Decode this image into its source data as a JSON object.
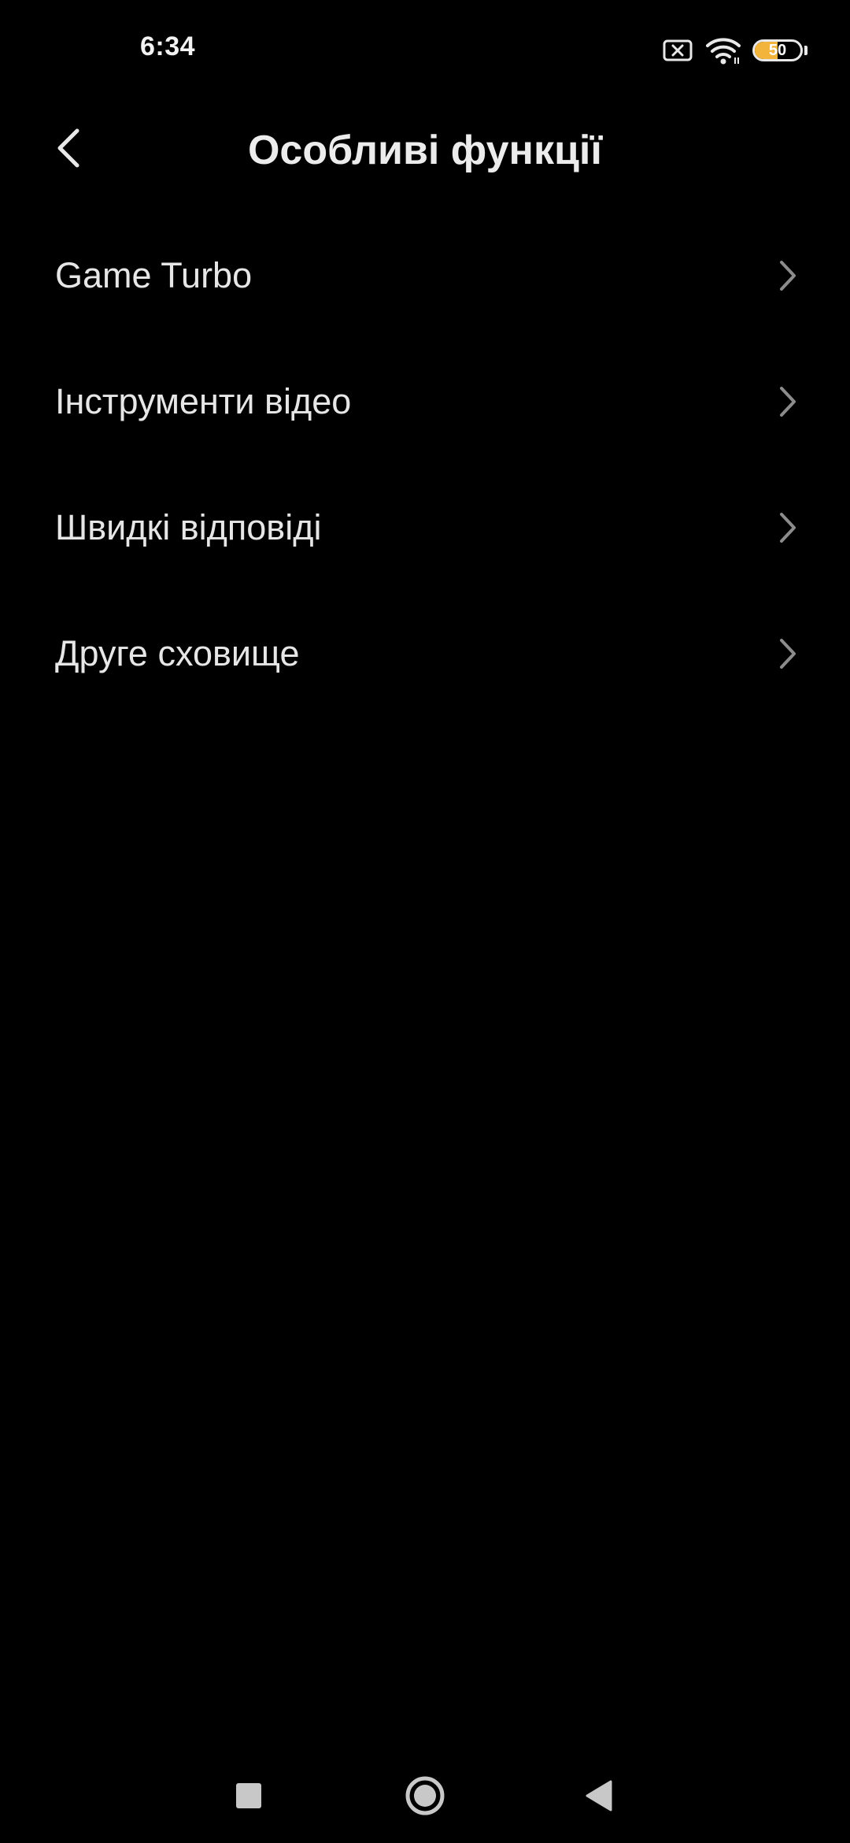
{
  "status_bar": {
    "time": "6:34",
    "battery_level": "50",
    "battery_fraction": 0.5,
    "icons": [
      "sim-missing-icon",
      "wifi-icon",
      "battery-icon"
    ]
  },
  "header": {
    "title": "Особливі функції",
    "back_icon": "chevron-left-icon"
  },
  "list": {
    "items": [
      {
        "label": "Game Turbo",
        "icon": "chevron-right-icon"
      },
      {
        "label": "Інструменти відео",
        "icon": "chevron-right-icon"
      },
      {
        "label": "Швидкі відповіді",
        "icon": "chevron-right-icon"
      },
      {
        "label": "Друге сховище",
        "icon": "chevron-right-icon"
      }
    ]
  },
  "nav_bar": {
    "buttons": [
      "recents-square-icon",
      "home-circle-icon",
      "back-triangle-icon"
    ]
  },
  "colors": {
    "background": "#000000",
    "text": "#ececec",
    "chevron": "#8c8c8c",
    "battery_accent": "#f2b43a"
  }
}
